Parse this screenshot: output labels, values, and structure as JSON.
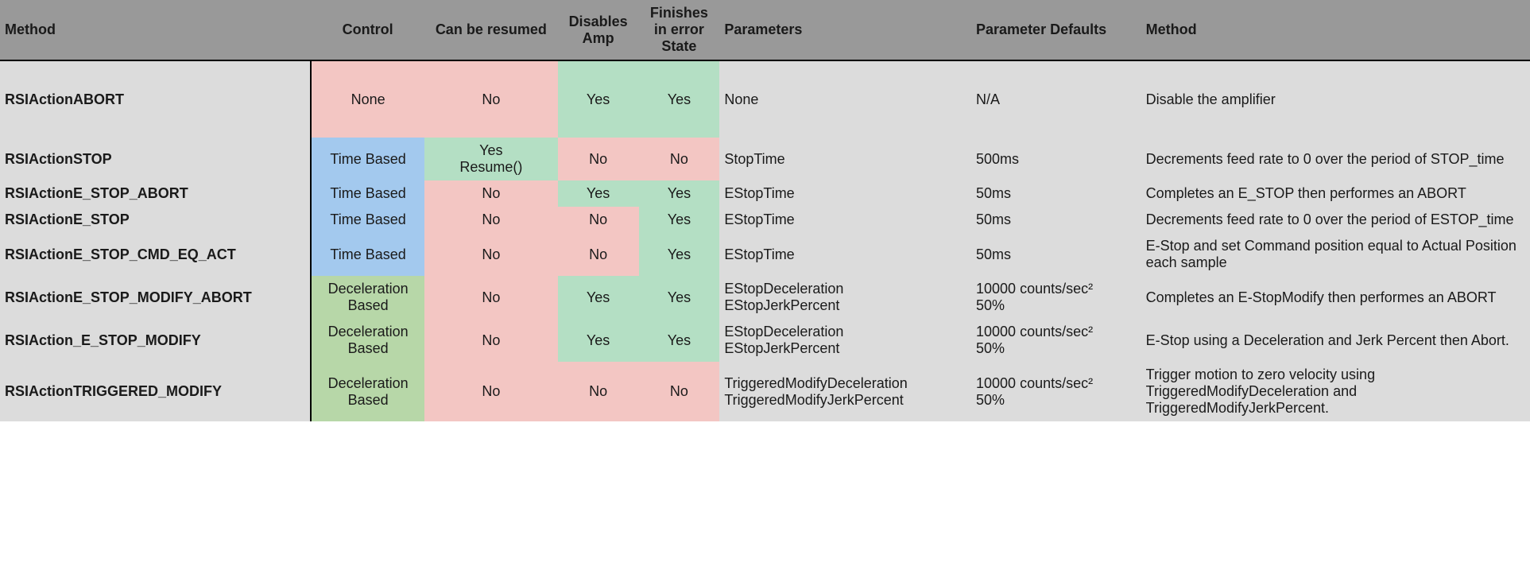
{
  "headers": {
    "method": "Method",
    "control": "Control",
    "resumed": "Can be resumed",
    "disables": "Disables Amp",
    "finishes": "Finishes in error State",
    "parameters": "Parameters",
    "defaults": "Parameter Defaults",
    "desc": "Method"
  },
  "rows": [
    {
      "name": "RSIActionABORT",
      "control": {
        "text": "None",
        "cls": "red"
      },
      "resumed": {
        "text": "No",
        "cls": "red"
      },
      "disables": {
        "text": "Yes",
        "cls": "green"
      },
      "finishes": {
        "text": "Yes",
        "cls": "green"
      },
      "params": "None",
      "defaults": "N/A",
      "desc": "Disable the amplifier",
      "tall": true
    },
    {
      "name": "RSIActionSTOP",
      "control": {
        "text": "Time Based",
        "cls": "blue"
      },
      "resumed": {
        "text": "Yes Resume()",
        "cls": "green",
        "multi": true
      },
      "disables": {
        "text": "No",
        "cls": "red"
      },
      "finishes": {
        "text": "No",
        "cls": "red"
      },
      "params": "StopTime",
      "defaults": "500ms",
      "desc": "Decrements feed rate to 0 over the period of STOP_time"
    },
    {
      "name": "RSIActionE_STOP_ABORT",
      "control": {
        "text": "Time Based",
        "cls": "blue"
      },
      "resumed": {
        "text": "No",
        "cls": "red"
      },
      "disables": {
        "text": "Yes",
        "cls": "green"
      },
      "finishes": {
        "text": "Yes",
        "cls": "green"
      },
      "params": "EStopTime",
      "defaults": "50ms",
      "desc": "Completes an E_STOP  then performes an ABORT"
    },
    {
      "name": "RSIActionE_STOP",
      "control": {
        "text": "Time Based",
        "cls": "blue"
      },
      "resumed": {
        "text": "No",
        "cls": "red"
      },
      "disables": {
        "text": "No",
        "cls": "red"
      },
      "finishes": {
        "text": "Yes",
        "cls": "green"
      },
      "params": "EStopTime",
      "defaults": "50ms",
      "desc": "Decrements feed rate to 0 over the period of ESTOP_time"
    },
    {
      "name": "RSIActionE_STOP_CMD_EQ_ACT",
      "control": {
        "text": "Time Based",
        "cls": "blue"
      },
      "resumed": {
        "text": "No",
        "cls": "red"
      },
      "disables": {
        "text": "No",
        "cls": "red"
      },
      "finishes": {
        "text": "Yes",
        "cls": "green"
      },
      "params": "EStopTime",
      "defaults": "50ms",
      "desc": "E-Stop and set Command position equal to Actual Position each sample"
    },
    {
      "name": "RSIActionE_STOP_MODIFY_ABORT",
      "control": {
        "text": "Deceleration Based",
        "cls": "dgrn",
        "multi": true
      },
      "resumed": {
        "text": "No",
        "cls": "red"
      },
      "disables": {
        "text": "Yes",
        "cls": "green"
      },
      "finishes": {
        "text": "Yes",
        "cls": "green"
      },
      "params": "EStopDeceleration EStopJerkPercent",
      "paramsMulti": true,
      "defaults": "10000 counts/sec² 50%",
      "defaultsMulti": true,
      "desc": "Completes an E-StopModify then performes an ABORT"
    },
    {
      "name": "RSIAction_E_STOP_MODIFY",
      "control": {
        "text": "Deceleration Based",
        "cls": "dgrn",
        "multi": true
      },
      "resumed": {
        "text": "No",
        "cls": "red"
      },
      "disables": {
        "text": "Yes",
        "cls": "green"
      },
      "finishes": {
        "text": "Yes",
        "cls": "green"
      },
      "params": "EStopDeceleration EStopJerkPercent",
      "paramsMulti": true,
      "defaults": "10000 counts/sec² 50%",
      "defaultsMulti": true,
      "desc": "E-Stop using a Deceleration and Jerk Percent then Abort."
    },
    {
      "name": "RSIActionTRIGGERED_MODIFY",
      "control": {
        "text": "Deceleration Based",
        "cls": "dgrn",
        "multi": true
      },
      "resumed": {
        "text": "No",
        "cls": "red"
      },
      "disables": {
        "text": "No",
        "cls": "red"
      },
      "finishes": {
        "text": "No",
        "cls": "red"
      },
      "params": "TriggeredModifyDeceleration TriggeredModifyJerkPercent",
      "paramsMulti": true,
      "defaults": "10000 counts/sec² 50%",
      "defaultsMulti": true,
      "desc": "Trigger motion to zero velocity using TriggeredModifyDeceleration and TriggeredModifyJerkPercent."
    }
  ]
}
